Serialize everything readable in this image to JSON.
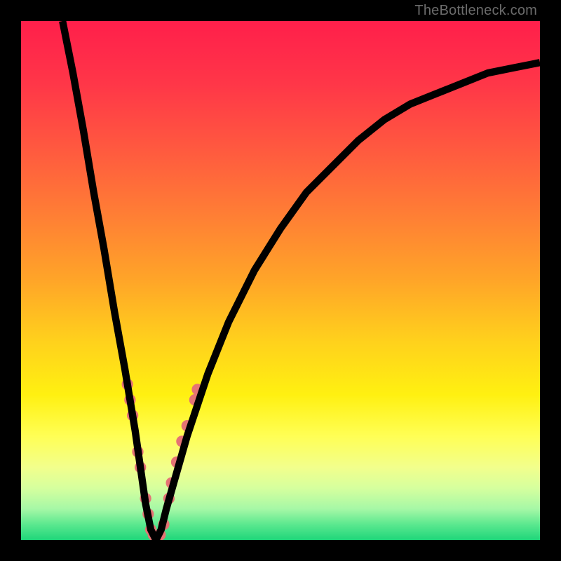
{
  "watermark": "TheBottleneck.com",
  "gradient": {
    "stops": [
      {
        "offset": 0.0,
        "color": "#ff1f4b"
      },
      {
        "offset": 0.12,
        "color": "#ff3648"
      },
      {
        "offset": 0.25,
        "color": "#ff5a3f"
      },
      {
        "offset": 0.38,
        "color": "#ff8034"
      },
      {
        "offset": 0.5,
        "color": "#ffa528"
      },
      {
        "offset": 0.62,
        "color": "#ffd21c"
      },
      {
        "offset": 0.72,
        "color": "#fff011"
      },
      {
        "offset": 0.8,
        "color": "#ffff55"
      },
      {
        "offset": 0.86,
        "color": "#f2ff8c"
      },
      {
        "offset": 0.9,
        "color": "#d6ff9e"
      },
      {
        "offset": 0.94,
        "color": "#a6f8a6"
      },
      {
        "offset": 0.97,
        "color": "#5be88f"
      },
      {
        "offset": 1.0,
        "color": "#1fd67a"
      }
    ]
  },
  "chart_data": {
    "type": "line",
    "title": "",
    "xlabel": "",
    "ylabel": "",
    "xlim": [
      0,
      100
    ],
    "ylim": [
      0,
      100
    ],
    "grid": false,
    "legend": false,
    "x": [
      8,
      10,
      12,
      14,
      16,
      18,
      20,
      21,
      22,
      23,
      24,
      25,
      26,
      27,
      28,
      30,
      32,
      36,
      40,
      45,
      50,
      55,
      60,
      65,
      70,
      75,
      80,
      85,
      90,
      95,
      100
    ],
    "y": [
      100,
      90,
      79,
      67,
      56,
      44,
      33,
      27,
      21,
      14,
      7,
      2,
      0,
      2,
      6,
      13,
      20,
      32,
      42,
      52,
      60,
      67,
      72,
      77,
      81,
      84,
      86,
      88,
      90,
      91,
      92
    ],
    "markers": {
      "color": "#e57374",
      "radius_rel": 1.1,
      "points": [
        {
          "x": 20.5,
          "y": 30
        },
        {
          "x": 21.0,
          "y": 27
        },
        {
          "x": 21.5,
          "y": 24
        },
        {
          "x": 22.5,
          "y": 17
        },
        {
          "x": 23.0,
          "y": 14
        },
        {
          "x": 24.0,
          "y": 8
        },
        {
          "x": 24.5,
          "y": 5
        },
        {
          "x": 25.0,
          "y": 2
        },
        {
          "x": 25.5,
          "y": 1
        },
        {
          "x": 26.0,
          "y": 0
        },
        {
          "x": 26.8,
          "y": 1
        },
        {
          "x": 27.5,
          "y": 3
        },
        {
          "x": 28.5,
          "y": 8
        },
        {
          "x": 29.0,
          "y": 11
        },
        {
          "x": 30.0,
          "y": 15
        },
        {
          "x": 31.0,
          "y": 19
        },
        {
          "x": 32.0,
          "y": 22
        },
        {
          "x": 33.5,
          "y": 27
        },
        {
          "x": 34.0,
          "y": 29
        }
      ]
    }
  }
}
